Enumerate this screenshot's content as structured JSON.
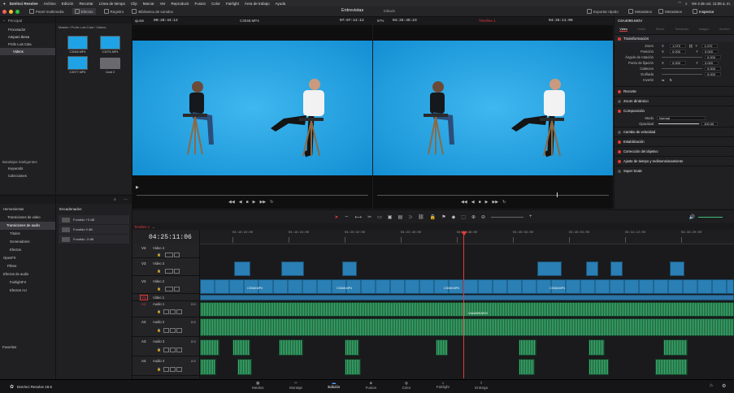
{
  "menubar": {
    "app": "DaVinci Resolve",
    "items": [
      "Archivo",
      "Edición",
      "Recortar",
      "Línea de tiempo",
      "Clip",
      "Marcar",
      "Ver",
      "Reproducir",
      "Fusion",
      "Color",
      "Fairlight",
      "Área de trabajo",
      "Ayuda"
    ],
    "clock": "Vie 4 de oct. 11:06 a. m."
  },
  "toolbar": {
    "media_pool": "Panel multimedia",
    "effects": "Efectos",
    "index": "Registro",
    "sound_library": "Biblioteca de sonidos",
    "project_title": "Entrevistas",
    "project_status": "Editado",
    "quick_export": "Exportar rápido",
    "metadata": "Metadatos",
    "metadata2": "Metadatos",
    "inspector": "Inspector"
  },
  "media_pool": {
    "sections_header": "Principal",
    "bins": [
      "Procesador",
      "Amparo Ibesa",
      "Profe Luis Cala",
      "Videos"
    ],
    "path": "Master / Profe Luis Cala / Videos",
    "clips": [
      {
        "name": "C3048.MP4",
        "type": "video"
      },
      {
        "name": "C3076.MP4",
        "type": "video"
      },
      {
        "name": "C3077.MP4",
        "type": "video"
      },
      {
        "name": "Card 2",
        "type": "folder"
      }
    ],
    "smart_bins_header": "Bandejas inteligentes",
    "smart_bins": [
      "Keywords",
      "Colecciones"
    ]
  },
  "source_viewer": {
    "zoom": "ajuste",
    "timecode": "00:28:44:12",
    "clip_name": "C3048.MP4",
    "duration": "07:07:14:12"
  },
  "timeline_viewer": {
    "zoom": "67%",
    "duration": "04:25:45:23",
    "timeline_name": "Timeline 1",
    "timecode": "04:25:11:06"
  },
  "inspector": {
    "clip_title": "C6A4099.MOV",
    "tabs": [
      "Video",
      "Audio",
      "Efecto",
      "Transición",
      "Imagen",
      "Archivo"
    ],
    "transform_header": "Transformación",
    "rows": [
      {
        "label": "Zoom",
        "x": "1.070",
        "y": "1.070"
      },
      {
        "label": "Posición",
        "x": "0.000",
        "y": "0.000"
      },
      {
        "label": "Ángulo de rotación",
        "x": "0.000",
        "y": ""
      },
      {
        "label": "Punto de fijación",
        "x": "0.000",
        "y": "0.000"
      },
      {
        "label": "Cabeceo",
        "x": "0.000",
        "y": ""
      },
      {
        "label": "Guiñada",
        "x": "0.000",
        "y": ""
      },
      {
        "label": "Invertir",
        "x": "",
        "y": ""
      }
    ],
    "sections": [
      "Recorte",
      "Zoom dinámico",
      "Composición"
    ],
    "composite_mode_label": "Modo",
    "composite_mode": "Normal",
    "opacity_label": "Opacidad",
    "opacity": "100.00",
    "more_sections": [
      "Cambio de velocidad",
      "Estabilización",
      "Corrección del objetivo",
      "Ajuste de tiempo y redimensionamiento",
      "Super Scale"
    ]
  },
  "effects": {
    "tree": [
      "Herramientas",
      "Transiciones de video",
      "Transiciones de audio",
      "Títulos",
      "Generadores",
      "Efectos",
      "OpenFX",
      "Filtros",
      "Efectos de audio",
      "FairlightFX",
      "Efectos AU"
    ],
    "favorites": "Favoritos",
    "list_header": "Encadenados",
    "list": [
      "Fundido +3 dB",
      "Fundido 0 dB",
      "Fundido -3 dB"
    ]
  },
  "timeline": {
    "tab": "Timeline 1",
    "timecode": "04:25:11:06",
    "ruler": [
      "04:16:16:00",
      "04:18:24:00",
      "04:20:32:00",
      "04:22:40:00",
      "04:24:48:00",
      "04:26:56:00",
      "04:29:04:00",
      "04:31:12:00",
      "04:33:20:00"
    ],
    "video_tracks": [
      {
        "id": "V4",
        "name": "Video 4"
      },
      {
        "id": "V3",
        "name": "Video 3"
      },
      {
        "id": "V2",
        "name": "Video 2"
      },
      {
        "id": "V1",
        "name": "Video 1"
      }
    ],
    "audio_tracks": [
      {
        "id": "A1",
        "name": "Audio 1",
        "level": "2.0"
      },
      {
        "id": "A2",
        "name": "Audio 2",
        "level": "2.0"
      },
      {
        "id": "A3",
        "name": "Audio 3",
        "level": "2.0"
      },
      {
        "id": "A4",
        "name": "Audio 4",
        "level": "2.0"
      }
    ],
    "clip_labels": [
      "C3048.MP4",
      "C3048.MP4",
      "C3048.MP4",
      "C3048.MP4",
      "C6A4099.MOV"
    ]
  },
  "pages": {
    "brand": "DaVinci Resolve 18.6",
    "items": [
      "Medios",
      "Montaje",
      "Edición",
      "Fusion",
      "Color",
      "Fairlight",
      "Entrega"
    ],
    "active": "Edición"
  },
  "colors": {
    "accent": "#e03b3b",
    "clip_video": "#2a7fb4",
    "clip_audio": "#1f5a3a",
    "backdrop": "#1fa3e6"
  }
}
